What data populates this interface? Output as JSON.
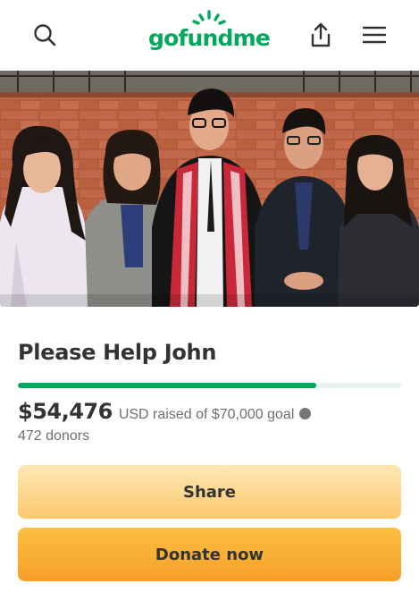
{
  "header": {
    "logo_text": "gofundme",
    "search_icon": "search-icon",
    "share_icon": "share-upload-icon",
    "menu_icon": "hamburger-menu-icon",
    "brand_color": "#02a95c"
  },
  "campaign": {
    "title": "Please Help John",
    "raised_amount": "$54,476",
    "raised_text": "USD raised of $70,000 goal",
    "progress_fraction": 0.778,
    "donors": "472 donors"
  },
  "actions": {
    "share_label": "Share",
    "donate_label": "Donate now",
    "share_color": "#fcd588",
    "donate_color": "#f9ad32"
  }
}
